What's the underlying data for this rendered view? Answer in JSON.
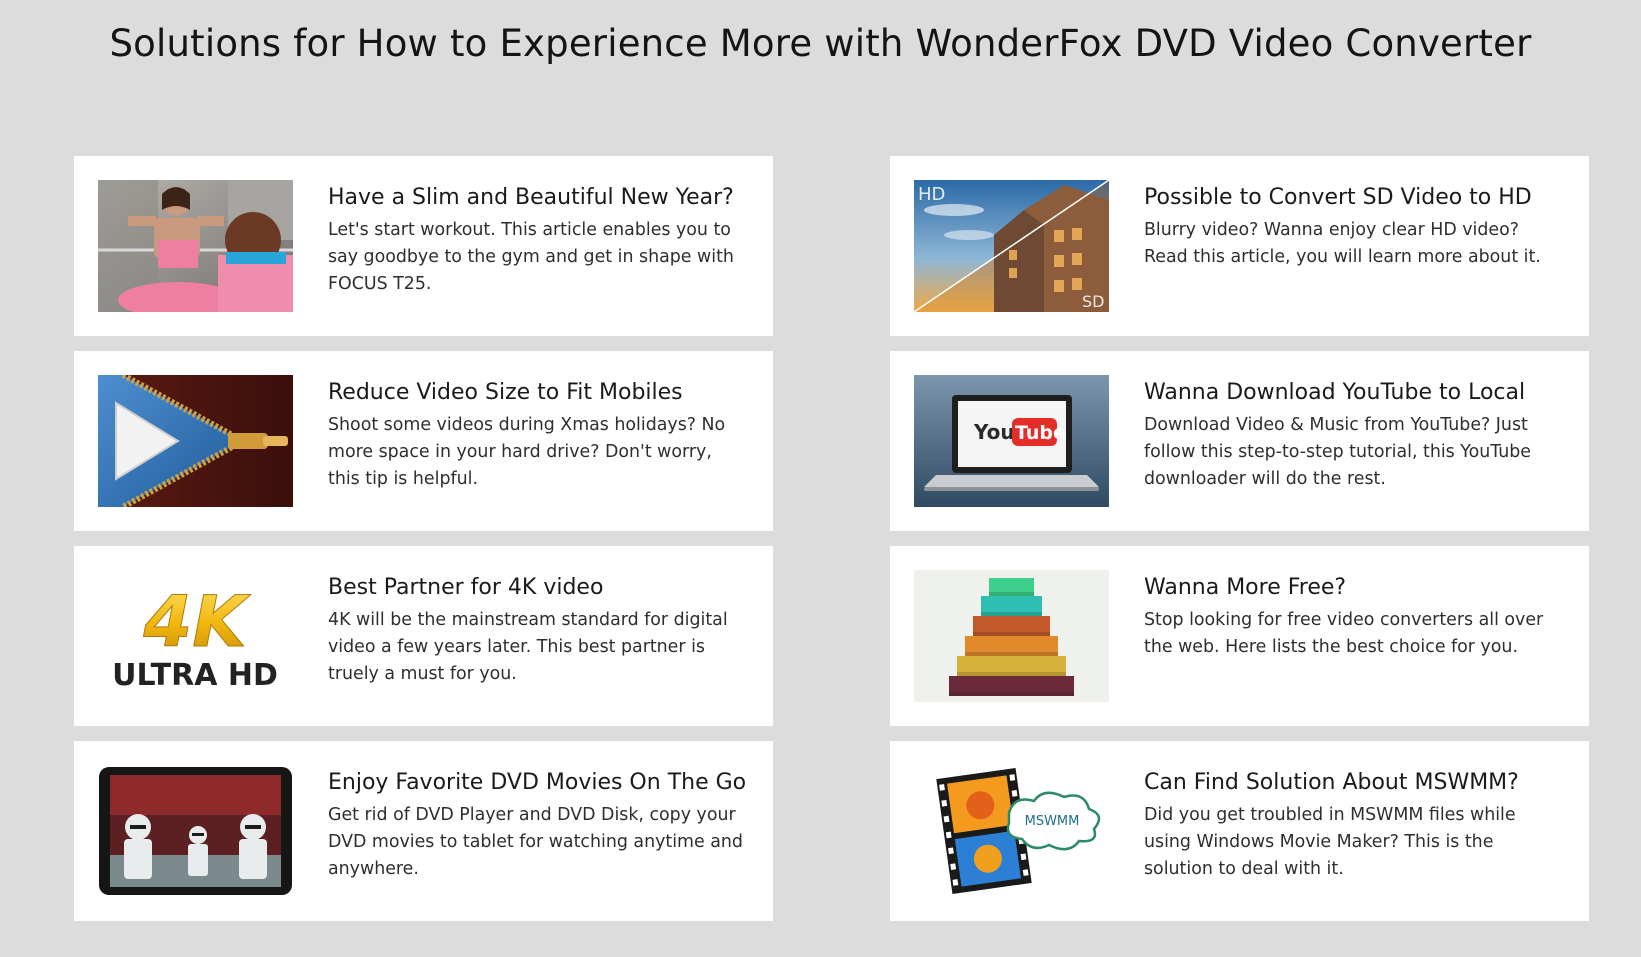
{
  "page": {
    "title": "Solutions for How to Experience More with WonderFox DVD Video Converter"
  },
  "cards": [
    {
      "title": "Have a Slim and Beautiful New Year?",
      "description": "Let's start workout. This article enables you to say goodbye to the gym and get in shape with FOCUS T25.",
      "image": "workout-photo"
    },
    {
      "title": "Possible to Convert SD Video to HD",
      "description": "Blurry video? Wanna enjoy clear HD video? Read this article, you will learn more about it.",
      "image": "sd-hd-comparison-photo",
      "image_labels": {
        "hd": "HD",
        "sd": "SD"
      }
    },
    {
      "title": "Reduce Video Size to Fit Mobiles",
      "description": "Shoot some videos during Xmas holidays? No more space in your hard drive? Don't worry, this tip is helpful.",
      "image": "zipper-play-icon"
    },
    {
      "title": "Wanna Download YouTube to Local",
      "description": "Download Video & Music from YouTube? Just follow this step-to-step tutorial, this YouTube downloader will do the rest.",
      "image": "youtube-laptop",
      "image_labels": {
        "you": "You",
        "tube": "Tube"
      }
    },
    {
      "title": "Best Partner for 4K video",
      "description": "4K will be the mainstream standard for digital video a few years later. This best partner is truely a must for you.",
      "image": "4k-ultra-hd-logo",
      "image_labels": {
        "big": "4K",
        "small": "ULTRA HD"
      }
    },
    {
      "title": "Wanna More Free?",
      "description": "Stop looking for free video converters all over the web. Here lists the best choice for you.",
      "image": "stairs-chart"
    },
    {
      "title": "Enjoy Favorite DVD Movies On The Go",
      "description": "Get rid of DVD Player and DVD Disk, copy your DVD movies to tablet for watching anytime and anywhere.",
      "image": "tablet-movie"
    },
    {
      "title": "Can Find Solution About MSWMM?",
      "description": "Did you get troubled in MSWMM files while using Windows Movie Maker? This is the solution to deal with it.",
      "image": "film-strip-flower",
      "image_labels": {
        "cloud": "MSWMM"
      }
    }
  ],
  "colors": {
    "background": "#dcdcdc",
    "card": "#ffffff",
    "text": "#1a1a1a",
    "youtube_red": "#e52d27",
    "gold_4k": "#f2b90f"
  }
}
